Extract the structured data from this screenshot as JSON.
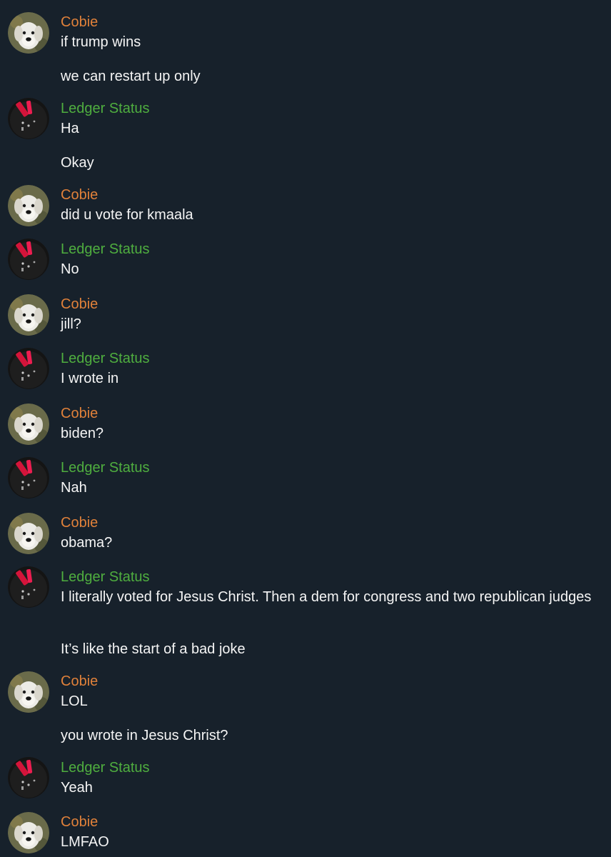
{
  "colors": {
    "background": "#17212b",
    "cobie_name": "#e0813a",
    "ledger_name": "#4fae3f",
    "message_text": "#f5f5f5"
  },
  "users": {
    "cobie": {
      "name": "Cobie",
      "avatar_icon": "white-dog-avatar-icon"
    },
    "ledger": {
      "name": "Ledger Status",
      "avatar_icon": "red-ledger-avatar-icon"
    }
  },
  "messages": [
    {
      "sender": "Cobie",
      "texts": [
        "if trump wins",
        "we can restart up only"
      ]
    },
    {
      "sender": "Ledger Status",
      "texts": [
        "Ha",
        "Okay"
      ]
    },
    {
      "sender": "Cobie",
      "texts": [
        "did u vote for kmaala"
      ]
    },
    {
      "sender": "Ledger Status",
      "texts": [
        "No"
      ]
    },
    {
      "sender": "Cobie",
      "texts": [
        "jill?"
      ]
    },
    {
      "sender": "Ledger Status",
      "texts": [
        "I wrote in"
      ]
    },
    {
      "sender": "Cobie",
      "texts": [
        "biden?"
      ]
    },
    {
      "sender": "Ledger Status",
      "texts": [
        "Nah"
      ]
    },
    {
      "sender": "Cobie",
      "texts": [
        "obama?"
      ]
    },
    {
      "sender": "Ledger Status",
      "texts": [
        "I literally voted for Jesus Christ. Then a dem for congress and two republican judges",
        "It’s like the start of a bad joke"
      ]
    },
    {
      "sender": "Cobie",
      "texts": [
        "LOL",
        "you wrote in Jesus Christ?"
      ]
    },
    {
      "sender": "Ledger Status",
      "texts": [
        "Yeah"
      ]
    },
    {
      "sender": "Cobie",
      "texts": [
        "LMFAO"
      ]
    }
  ]
}
